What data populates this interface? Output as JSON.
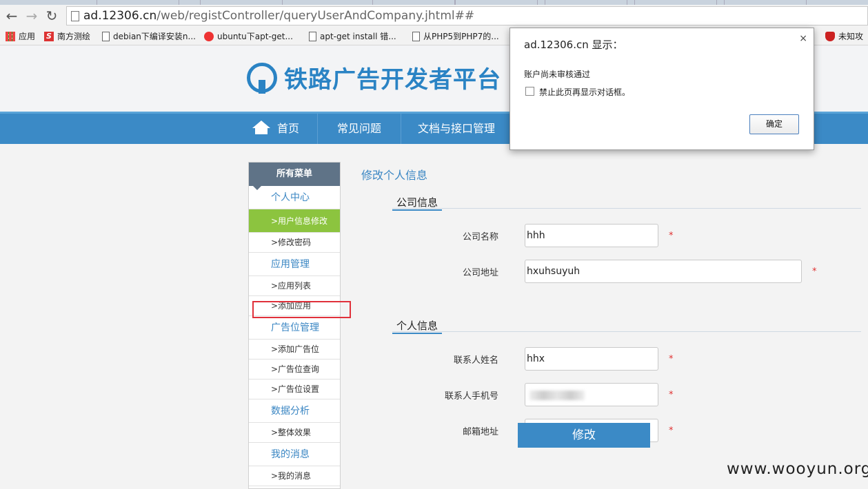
{
  "browser": {
    "url_host": "ad.12306.cn",
    "url_path": "/web/registController/queryUserAndCompany.jhtml##",
    "bookmarks": [
      {
        "label": "应用",
        "icon": "apps-icon"
      },
      {
        "label": "南方测绘",
        "icon": "s-logo-icon"
      },
      {
        "label": "debian下编译安装n...",
        "icon": "page-icon"
      },
      {
        "label": "ubuntu下apt-get...",
        "icon": "baidu-icon"
      },
      {
        "label": "apt-get install 错...",
        "icon": "page-icon"
      },
      {
        "label": "从PHP5到PHP7的...",
        "icon": "page-icon"
      },
      {
        "label": "未知攻",
        "icon": "shield-icon"
      }
    ]
  },
  "header": {
    "logo_text": "铁路广告开发者平台"
  },
  "nav": {
    "items": [
      "首页",
      "常见问题",
      "文档与接口管理"
    ]
  },
  "sidebar": {
    "title": "所有菜单",
    "groups": [
      {
        "label": "个人中心",
        "items": [
          ">用户信息修改",
          ">修改密码"
        ]
      },
      {
        "label": "应用管理",
        "items": [
          ">应用列表",
          ">添加应用"
        ]
      },
      {
        "label": "广告位管理",
        "items": [
          ">添加广告位",
          ">广告位查询",
          ">广告位设置"
        ]
      },
      {
        "label": "数据分析",
        "items": [
          ">整体效果"
        ]
      },
      {
        "label": "我的消息",
        "items": [
          ">我的消息"
        ]
      }
    ]
  },
  "content": {
    "page_title": "修改个人信息",
    "company_section": "公司信息",
    "company_name_label": "公司名称",
    "company_name_value": "hhh",
    "company_addr_label": "公司地址",
    "company_addr_value": "hxuhsuyuh",
    "personal_section": "个人信息",
    "contact_name_label": "联系人姓名",
    "contact_name_value": "hhx",
    "contact_phone_label": "联系人手机号",
    "email_label": "邮箱地址",
    "required_mark": "*",
    "submit_label": "修改"
  },
  "dialog": {
    "title": "ad.12306.cn 显示：",
    "message": "账户尚未审核通过",
    "checkbox_label": "禁止此页再显示对话框。",
    "ok_label": "确定",
    "close_glyph": "×"
  },
  "watermark": "www.wooyun.org"
}
